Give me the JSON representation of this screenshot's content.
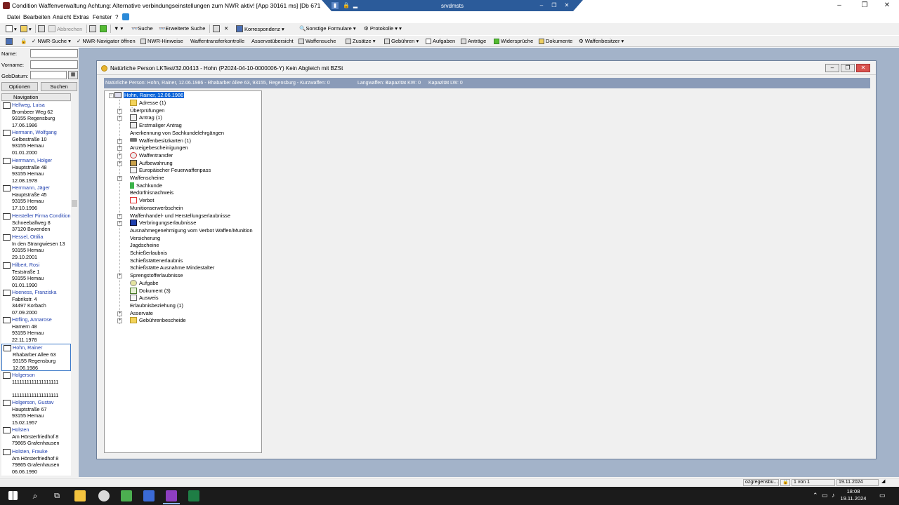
{
  "window": {
    "title": "Condition Waffenverwaltung Achtung: Alternative verbindungseinstellungen zum NWR aktiv! [App 30161 ms] [Db 671 ms] [Db",
    "rdp_title": "srvdmsts",
    "minimize": "–",
    "restore": "❐",
    "close": "✕"
  },
  "menu": [
    "Datei",
    "Bearbeiten",
    "Ansicht",
    "Extras",
    "Fenster",
    "?"
  ],
  "toolbar1": {
    "abbrechen": "Abbrechen",
    "suche": "Suche",
    "erweiterte_suche": "Erweiterte Suche",
    "korrespondenz": "Korrespondenz",
    "sonstige_formulare": "Sonstige Formulare",
    "protokolle": "Protokolle"
  },
  "toolbar2": {
    "nwr_suche": "NWR-Suche",
    "nwr_navigator": "NWR-Navigator öffnen",
    "nwr_hinweise": "NWR-Hinweise",
    "waffentransferkontrolle": "Waffentransferkontrolle",
    "asservatuebersicht": "Asservatübersicht",
    "waffensuche": "Waffensuche",
    "zusaetze": "Zusätze",
    "gebuehren": "Gebühren",
    "aufgaben": "Aufgaben",
    "antraege": "Anträge",
    "widersprueche": "Widersprüche",
    "dokumente": "Dokumente",
    "waffenbesitzer": "Waffenbesitzer"
  },
  "search": {
    "name_label": "Name:",
    "vorname_label": "Vorname:",
    "gebdatum_label": "GebDatum:",
    "options_button": "Optionen",
    "search_button": "Suchen"
  },
  "navigation": {
    "header": "Navigation",
    "items": [
      {
        "name": "Hellweg, Luisa",
        "lines": [
          "Brombeer Weg 62",
          "93155 Regensburg",
          "17.06.1986"
        ]
      },
      {
        "name": "Hermann, Wolfgang",
        "lines": [
          "Gelbestraße 10",
          "93155 Hemau",
          "01.01.2000"
        ]
      },
      {
        "name": "Herrmann, Holger",
        "lines": [
          "Hauptstraße 48",
          "93155 Hemau",
          "12.08.1978"
        ]
      },
      {
        "name": "Herrmann, Jäger",
        "lines": [
          "Hauptstraße 45",
          "93155 Hemau",
          "17.10.1996"
        ]
      },
      {
        "name": "Hersteller Firma Condition",
        "lines": [
          "Schneeballweg 8",
          "37120 Bovenden"
        ]
      },
      {
        "name": "Hessel, Ottilia",
        "lines": [
          "In den Strangwiesen 13",
          "93155 Hemau",
          "29.10.2001"
        ]
      },
      {
        "name": "Hilbert, Rosi",
        "lines": [
          "Teststraße 1",
          "93155 Hemau",
          "01.01.1990"
        ]
      },
      {
        "name": "Hoeness, Franziska",
        "lines": [
          "Fabrikstr. 4",
          "34497 Korbach",
          "07.09.2000"
        ]
      },
      {
        "name": "Höfling, Annarose",
        "lines": [
          "Hamern 48",
          "93155 Hemau",
          "22.11.1978"
        ]
      },
      {
        "name": "Hohn, Rainer",
        "lines": [
          "Rhabarber Allee 63",
          "93155 Regensburg",
          "12.06.1986"
        ]
      },
      {
        "name": "Holgerson",
        "lines": [
          "1111111111111111111",
          "",
          "1111111111111111111"
        ]
      },
      {
        "name": "Holgerson, Gustav",
        "lines": [
          "Hauptstraße 67",
          "93155 Hemau",
          "15.02.1957"
        ]
      },
      {
        "name": "Holsten",
        "lines": [
          "Am Hörsterfriedhof 8",
          "79865 Grafenhausen"
        ]
      },
      {
        "name": "Holsten, Frauke",
        "lines": [
          "Am Hörsterfriedhof 8",
          "79865 Grafenhausen",
          "06.06.1990"
        ]
      }
    ]
  },
  "child_window": {
    "title": "Natürliche Person LKTest/32.00413 - Hohn (P2024-04-10-0000006-Y) Kein Abgleich mit BZSt",
    "info": {
      "person": "Natürliche Person: Hohn, Rainer, 12.06.1986 - Rhabarber Allee 63, 93155, Regensburg - Kurzwaffen: 0",
      "langwaffen": "Langwaffen: 0",
      "kapazitaet_kw": "Kapazität KW: 0",
      "kapazitaet_lw": "Kapazität LW: 0"
    },
    "tree": {
      "root": "Hohn, Rainer, 12.06.1986",
      "nodes": [
        {
          "label": "Adresse (1)",
          "icon": "folder",
          "expander": false
        },
        {
          "label": "Überprüfungen",
          "icon": "none",
          "expander": true
        },
        {
          "label": "Antrag (1)",
          "icon": "grid",
          "expander": true
        },
        {
          "label": "Erstmaliger Antrag",
          "icon": "grid",
          "expander": false
        },
        {
          "label": "Anerkennung von Sachkundelehrgängen",
          "icon": "none",
          "expander": false
        },
        {
          "label": "Waffenbesitzkarten (1)",
          "icon": "gun",
          "expander": true
        },
        {
          "label": "Anzeigebescheinigungen",
          "icon": "none",
          "expander": true
        },
        {
          "label": "Waffentransfer",
          "icon": "transfer",
          "expander": true
        },
        {
          "label": "Aufbewahrung",
          "icon": "house",
          "expander": true
        },
        {
          "label": "Europäischer Feuerwaffenpass",
          "icon": "card",
          "expander": false
        },
        {
          "label": "Waffenscheine",
          "icon": "none",
          "expander": true
        },
        {
          "label": "Sachkunde",
          "icon": "flag",
          "expander": false
        },
        {
          "label": "Bedürfnisnachweis",
          "icon": "none",
          "expander": false
        },
        {
          "label": "Verbot",
          "icon": "ban",
          "expander": false
        },
        {
          "label": "Munitionserwerbschein",
          "icon": "none",
          "expander": false
        },
        {
          "label": "Waffenhandel- und Herstellungserlaubnisse",
          "icon": "none",
          "expander": true
        },
        {
          "label": "Verbringungserlaubnisse",
          "icon": "eu",
          "expander": true
        },
        {
          "label": "Ausnahmegenehmigung vom Verbot Waffen/Munition",
          "icon": "none",
          "expander": false
        },
        {
          "label": "Versicherung",
          "icon": "none",
          "expander": false
        },
        {
          "label": "Jagdscheine",
          "icon": "none",
          "expander": false
        },
        {
          "label": "Schießerlaubnis",
          "icon": "none",
          "expander": false
        },
        {
          "label": "Schießstättenerlaubnis",
          "icon": "none",
          "expander": false
        },
        {
          "label": "Schießstätte Ausnahme Mindestalter",
          "icon": "none",
          "expander": false
        },
        {
          "label": "Sprengstofferlaubnisse",
          "icon": "none",
          "expander": true
        },
        {
          "label": "Aufgabe",
          "icon": "task",
          "expander": false
        },
        {
          "label": "Dokument (3)",
          "icon": "doc",
          "expander": false
        },
        {
          "label": "Ausweis",
          "icon": "card",
          "expander": false
        },
        {
          "label": "Erlaubnisbeziehung (1)",
          "icon": "none",
          "expander": false
        },
        {
          "label": "Asservate",
          "icon": "none",
          "expander": true
        },
        {
          "label": "Gebührenbescheide",
          "icon": "folder",
          "expander": true
        }
      ]
    }
  },
  "statusbar": {
    "user": "ozgregensbu...",
    "page": "1 von 1",
    "date": "19.11.2024"
  },
  "taskbar": {
    "time": "18:08",
    "date": "19.11.2024"
  }
}
